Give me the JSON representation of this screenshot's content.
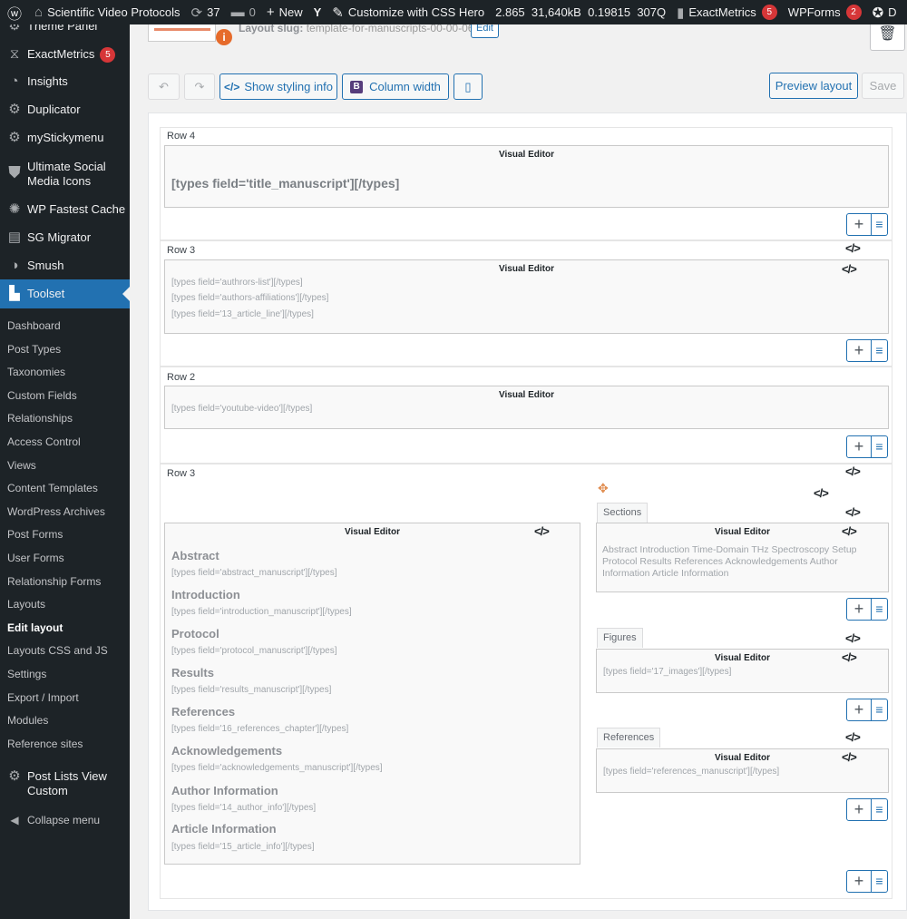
{
  "adminbar": {
    "site_name": "Scientific Video Protocols",
    "updates_count": "37",
    "comments_count": "0",
    "new_label": "New",
    "css_hero_label": "Customize with CSS Hero",
    "stat_1": "2.865",
    "stat_2": "31,640kB",
    "stat_3": "0.19815",
    "stat_4": "307Q",
    "exactmetrics_label": "ExactMetrics",
    "exactmetrics_badge": "5",
    "wpforms_label": "WPForms",
    "wpforms_badge": "2",
    "trailing_label": "D"
  },
  "sidebar": {
    "theme_panel": "Theme Panel",
    "exactmetrics": "ExactMetrics",
    "exactmetrics_badge": "5",
    "insights": "Insights",
    "duplicator": "Duplicator",
    "mystickymenu": "myStickymenu",
    "ultimate_social_1": "Ultimate Social",
    "ultimate_social_2": "Media Icons",
    "wp_fastest_cache": "WP Fastest Cache",
    "sg_migrator": "SG Migrator",
    "smush": "Smush",
    "toolset": "Toolset",
    "submenu": [
      "Dashboard",
      "Post Types",
      "Taxonomies",
      "Custom Fields",
      "Relationships",
      "Access Control",
      "Views",
      "Content Templates",
      "WordPress Archives",
      "Post Forms",
      "User Forms",
      "Relationship Forms",
      "Layouts",
      "Edit layout",
      "Layouts CSS and JS",
      "Settings",
      "Export / Import",
      "Modules",
      "Reference sites"
    ],
    "post_lists_1": "Post Lists View",
    "post_lists_2": "Custom",
    "collapse": "Collapse menu"
  },
  "header": {
    "slug_label": "Layout slug:",
    "slug_value": "template-for-manuscripts-00-00-06",
    "edit_label": "Edit"
  },
  "toolbar": {
    "show_styling": "Show styling info",
    "column_width": "Column width",
    "preview": "Preview layout",
    "save": "Save"
  },
  "editor": {
    "visual_editor": "Visual Editor",
    "row4": {
      "label": "Row 4",
      "title_field": "[types field='title_manuscript'][/types]"
    },
    "row3a": {
      "label": "Row 3",
      "lines": [
        "[types field='authrors-list'][/types]",
        "[types field='authors-affiliations'][/types]",
        "[types field='13_article_line'][/types]"
      ]
    },
    "row2": {
      "label": "Row 2",
      "line": "[types field='youtube-video'][/types]"
    },
    "row3b": {
      "label": "Row 3",
      "sections": [
        {
          "heading": "Abstract",
          "field": "[types field='abstract_manuscript'][/types]"
        },
        {
          "heading": "Introduction",
          "field": "[types field='introduction_manuscript'][/types]"
        },
        {
          "heading": "Protocol",
          "field": "[types field='protocol_manuscript'][/types]"
        },
        {
          "heading": "Results",
          "field": "[types field='results_manuscript'][/types]"
        },
        {
          "heading": "References",
          "field": "[types field='16_references_chapter'][/types]"
        },
        {
          "heading": "Acknowledgements",
          "field": "[types field='acknowledgements_manuscript'][/types]"
        },
        {
          "heading": "Author Information",
          "field": "[types field='14_author_info'][/types]"
        },
        {
          "heading": "Article Information",
          "field": "[types field='15_article_info'][/types]"
        }
      ],
      "sections_tab": "Sections",
      "sections_text": "Abstract Introduction Time-Domain THz Spectroscopy Setup Protocol Results References Acknowledgements Author Information Article Information",
      "figures_tab": "Figures",
      "figures_field": "[types field='17_images'][/types]",
      "references_tab": "References",
      "references_field": "[types field='references_manuscript'][/types]"
    }
  }
}
